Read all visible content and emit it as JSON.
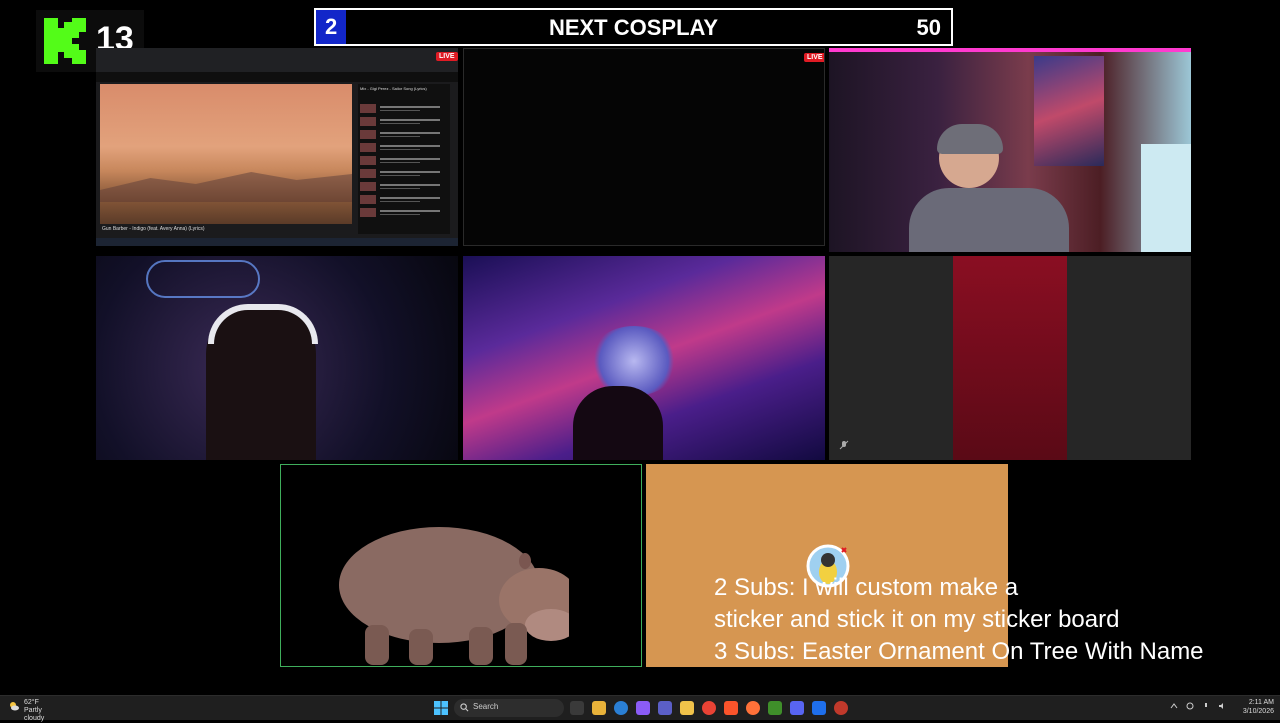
{
  "overlay": {
    "viewer_count": "13",
    "goal_banner": {
      "current": "2",
      "title": "NEXT COSPLAY",
      "target": "50"
    },
    "live_badge": "LIVE",
    "sub_goals": [
      "2 Subs: I will custom make a",
      "sticker and stick it on my sticker board",
      "3 Subs: Easter Ornament On Tree With Name"
    ]
  },
  "screen_share": {
    "video_title": "Gun Barber - Indigo (feat. Avery Anna) (Lyrics)",
    "up_next_title": "Mix - Gigi Perez - Sailor Song (Lyrics)"
  },
  "taskbar": {
    "weather_temp": "62°F",
    "weather_condition": "Partly cloudy",
    "search_placeholder": "Search",
    "time": "2:11 AM",
    "date": "3/10/2026"
  },
  "colors": {
    "kick_green": "#53fc18",
    "banner_blue": "#1226c9",
    "live_red": "#e01b24",
    "orange_panel": "#d69651",
    "hippo_border": "#3fae5c"
  }
}
